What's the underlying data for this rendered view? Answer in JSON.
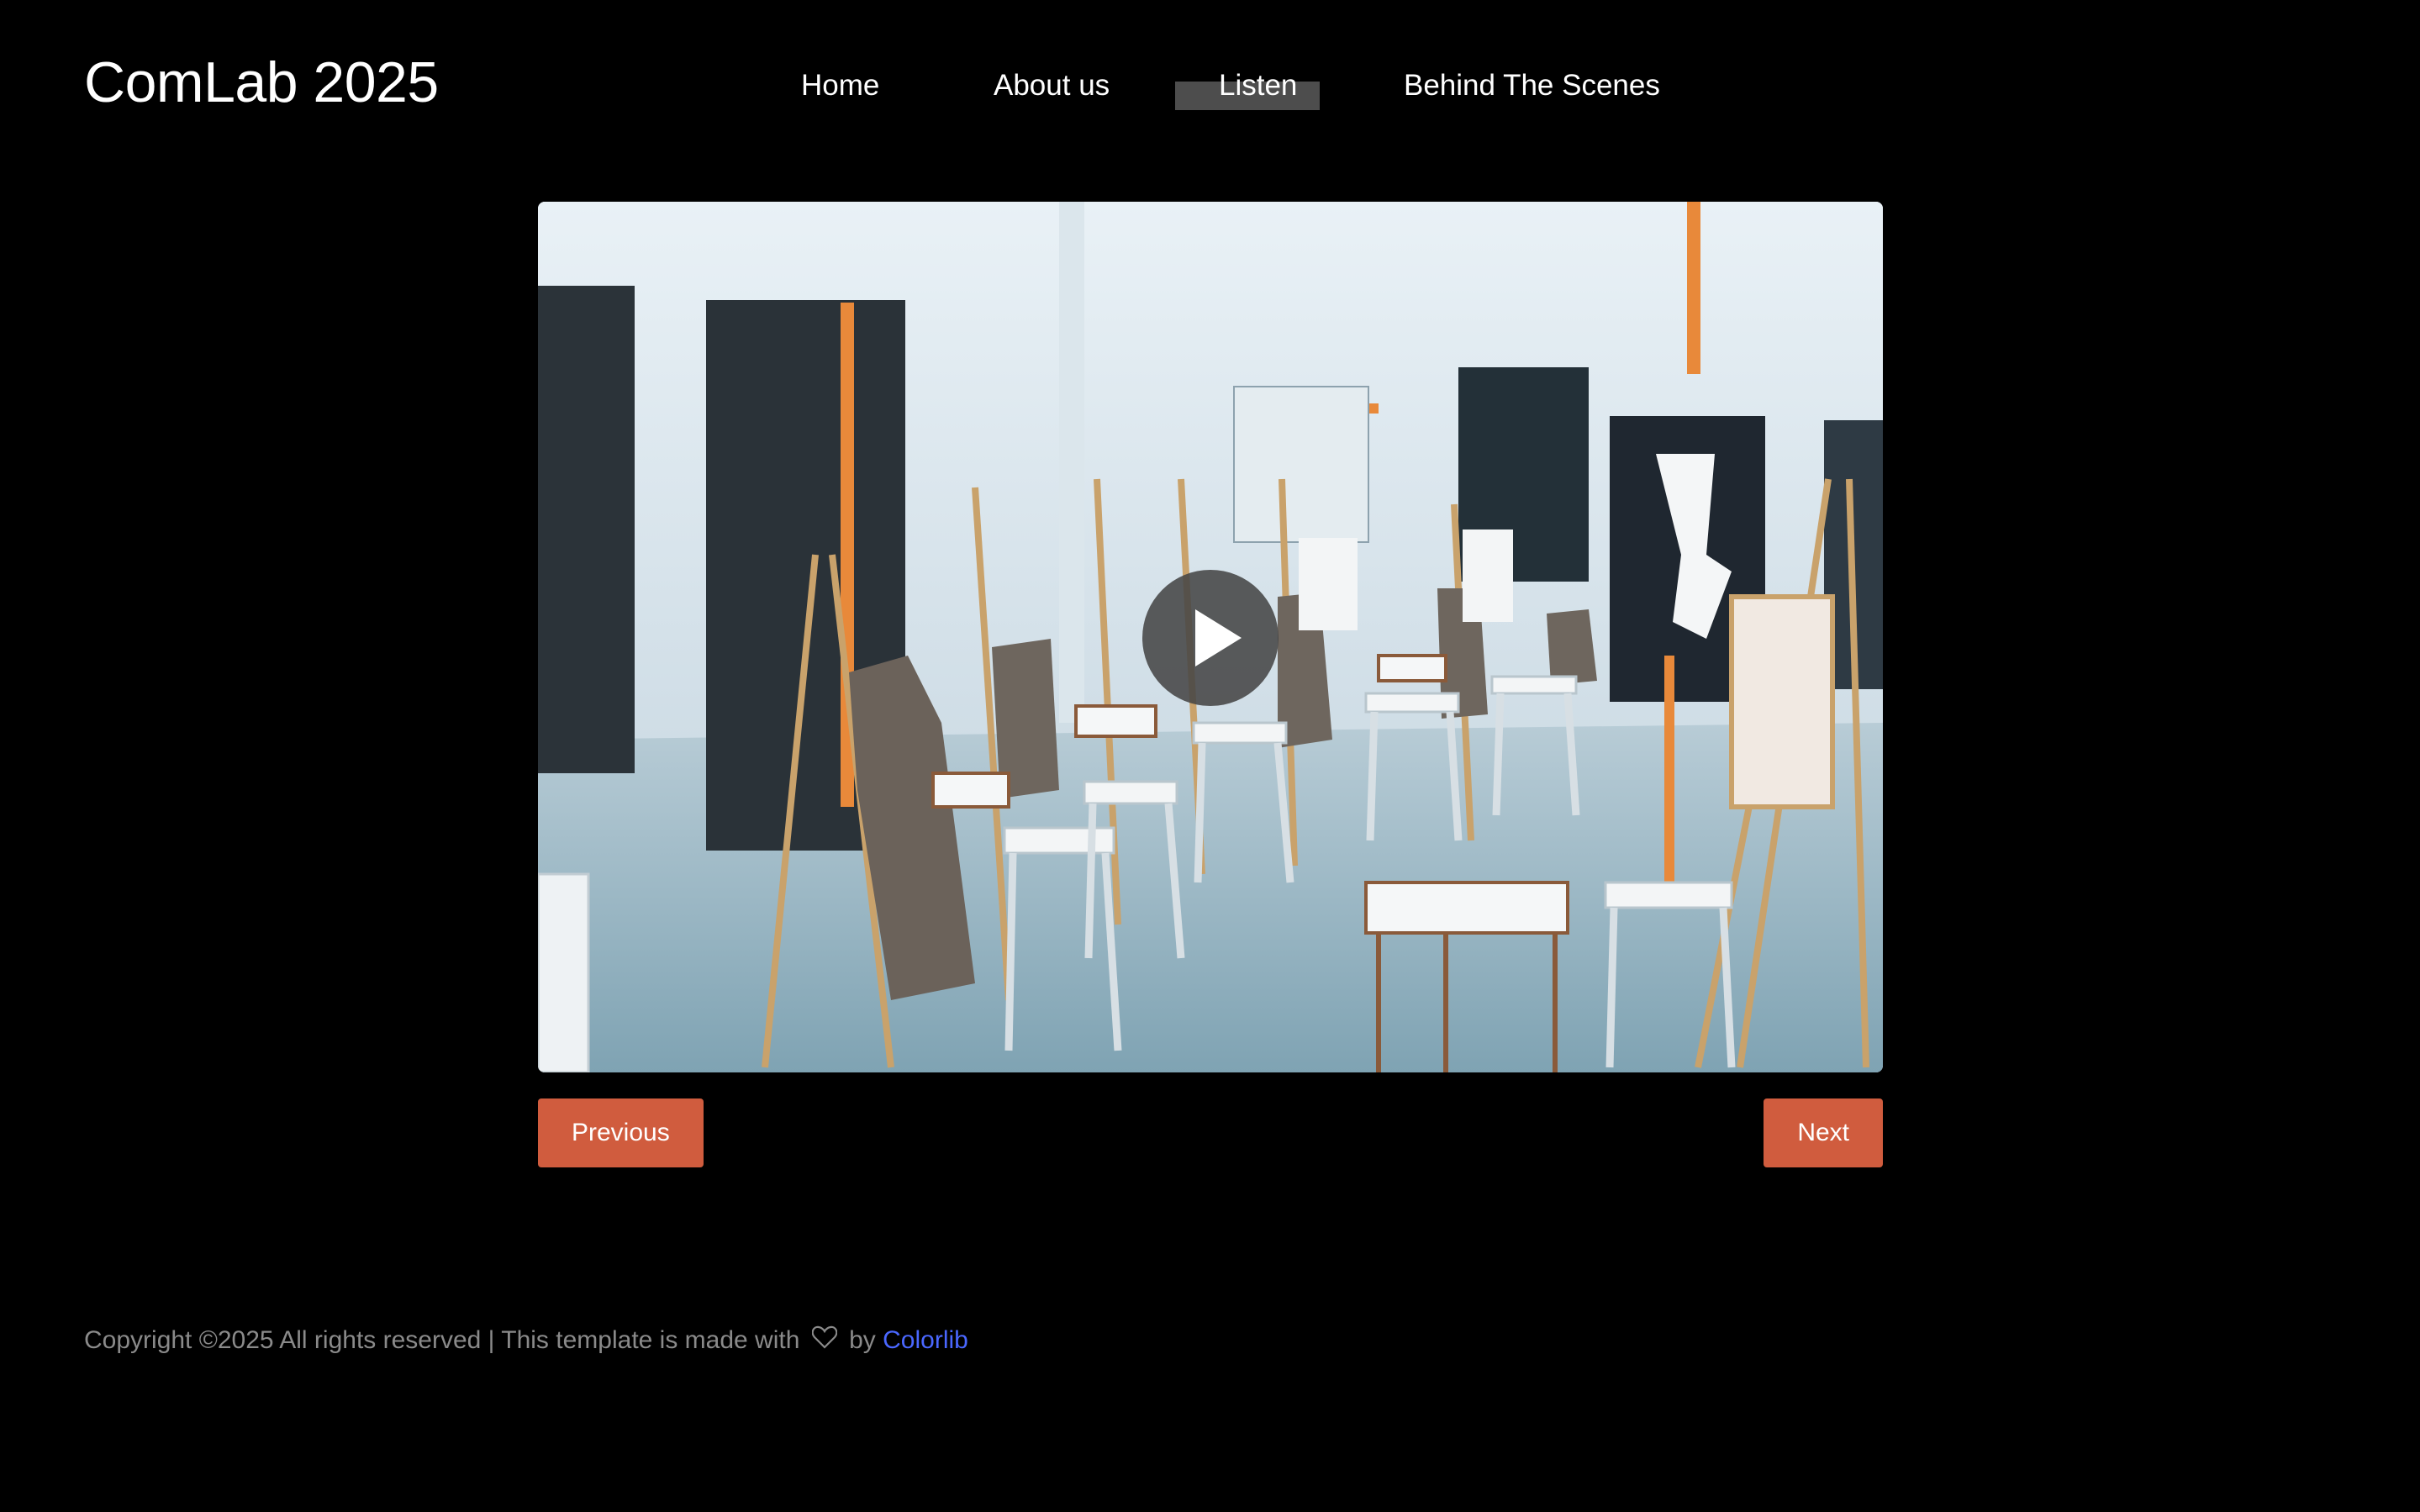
{
  "header": {
    "logo": "ComLab 2025",
    "nav": [
      {
        "label": "Home",
        "active": false
      },
      {
        "label": "About us",
        "active": false
      },
      {
        "label": "Listen",
        "active": true
      },
      {
        "label": "Behind The Scenes",
        "active": false
      }
    ]
  },
  "media": {
    "play_icon": "play-icon",
    "buttons": {
      "previous_label": "Previous",
      "next_label": "Next"
    }
  },
  "footer": {
    "copyright_text": "Copyright ©2025 All rights reserved | This template is made with",
    "heart_icon": "heart-icon",
    "by_text": "by",
    "link_text": "Colorlib"
  },
  "colors": {
    "background": "#000000",
    "accent_button": "#d05c3e",
    "nav_active_highlight": "#4d4d4d",
    "link": "#4a67ff",
    "footer_text": "#8a8a8a"
  }
}
